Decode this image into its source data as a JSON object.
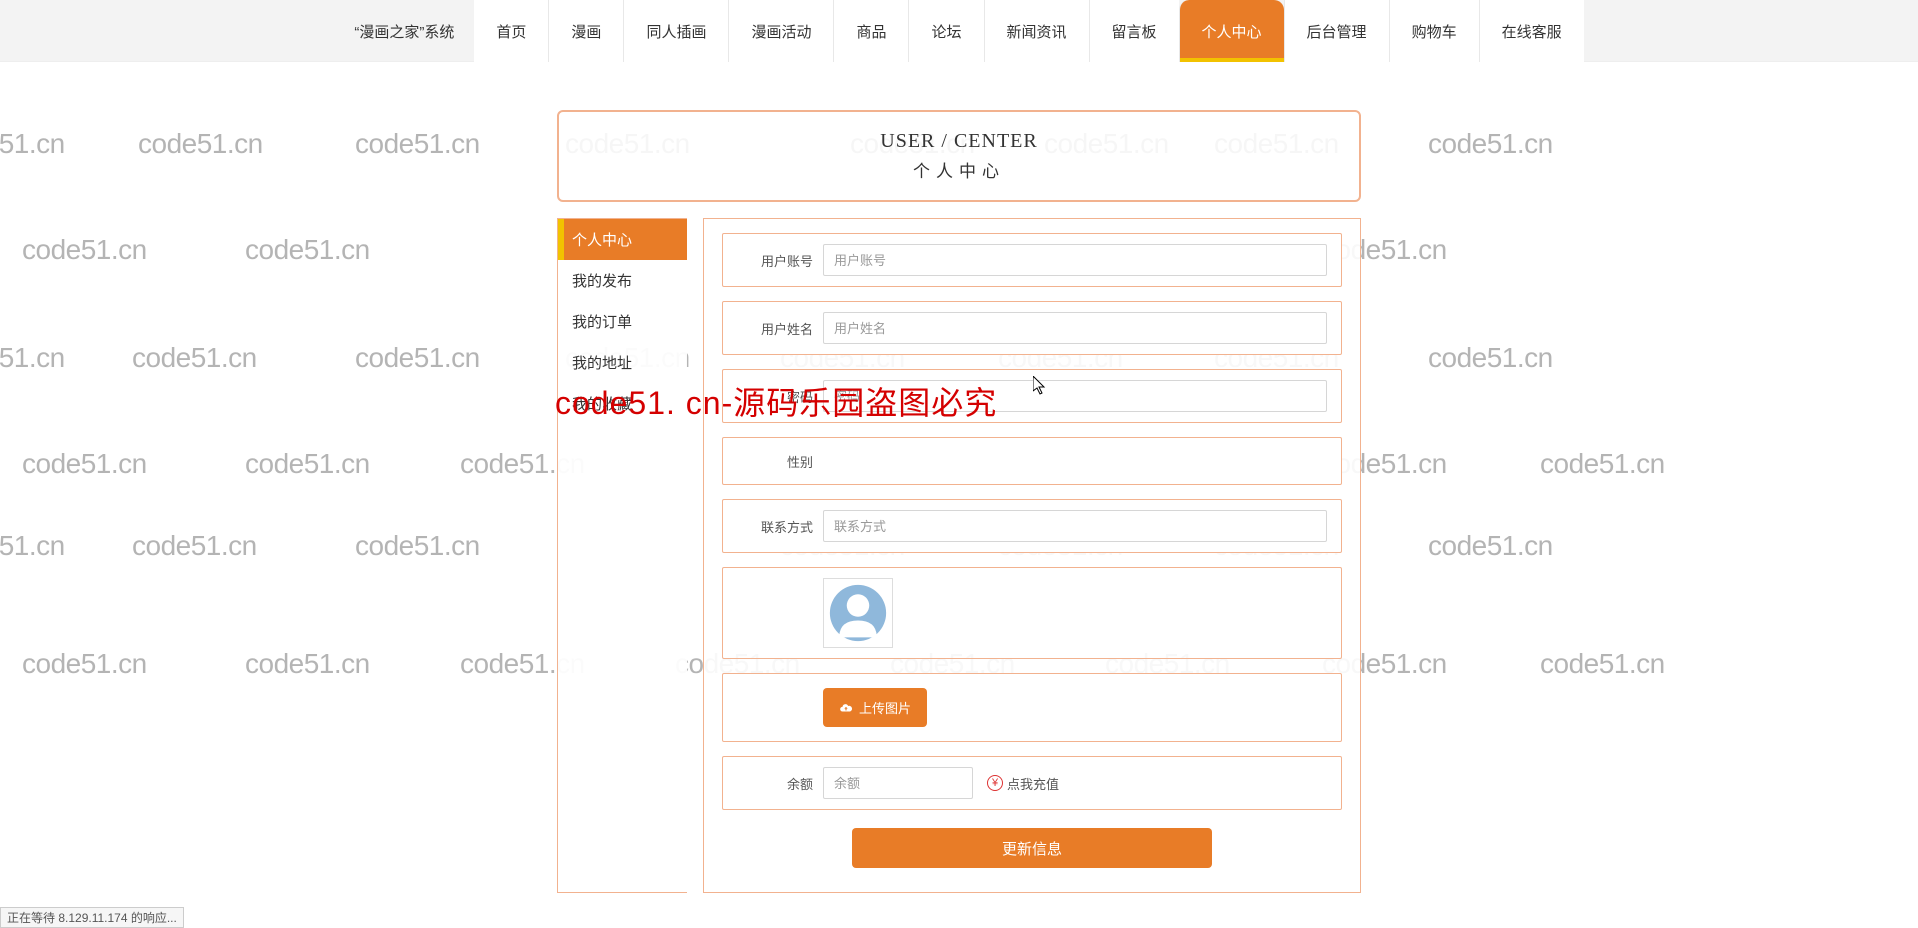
{
  "watermark_text": "code51.cn",
  "brand": "“漫画之家”系统",
  "nav": [
    {
      "label": "首页",
      "active": false
    },
    {
      "label": "漫画",
      "active": false
    },
    {
      "label": "同人插画",
      "active": false
    },
    {
      "label": "漫画活动",
      "active": false
    },
    {
      "label": "商品",
      "active": false
    },
    {
      "label": "论坛",
      "active": false
    },
    {
      "label": "新闻资讯",
      "active": false
    },
    {
      "label": "留言板",
      "active": false
    },
    {
      "label": "个人中心",
      "active": true
    },
    {
      "label": "后台管理",
      "active": false
    },
    {
      "label": "购物车",
      "active": false
    },
    {
      "label": "在线客服",
      "active": false
    }
  ],
  "title": {
    "en": "USER / CENTER",
    "cn": "个人中心"
  },
  "sidebar": [
    {
      "label": "个人中心",
      "active": true
    },
    {
      "label": "我的发布",
      "active": false
    },
    {
      "label": "我的订单",
      "active": false
    },
    {
      "label": "我的地址",
      "active": false
    },
    {
      "label": "我的收藏",
      "active": false
    }
  ],
  "form": {
    "account": {
      "label": "用户账号",
      "placeholder": "用户账号",
      "value": ""
    },
    "name": {
      "label": "用户姓名",
      "placeholder": "用户姓名",
      "value": ""
    },
    "password": {
      "label": "密码",
      "placeholder": "密码",
      "value": ""
    },
    "gender": {
      "label": "性别",
      "placeholder": "",
      "value": ""
    },
    "contact": {
      "label": "联系方式",
      "placeholder": "联系方式",
      "value": ""
    },
    "upload_label": "上传图片",
    "balance": {
      "label": "余额",
      "placeholder": "余额",
      "value": ""
    },
    "recharge_label": "点我充值",
    "submit_label": "更新信息"
  },
  "overlay_text": "code51. cn-源码乐园盗图必究",
  "status_text": "正在等待 8.129.11.174 的响应..."
}
